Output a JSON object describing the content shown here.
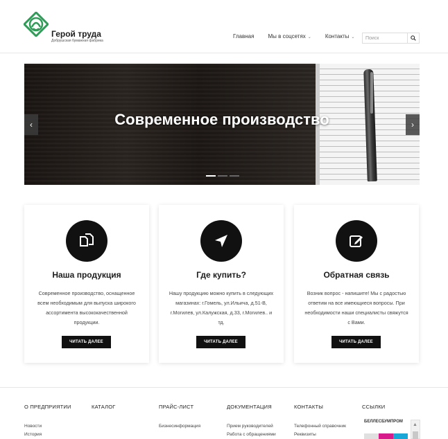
{
  "header": {
    "logo_title": "Герой труда",
    "logo_subtitle": "Добрушская бумажная фабрика",
    "nav": [
      {
        "label": "Главная",
        "has_dropdown": false
      },
      {
        "label": "Мы в соцсетях",
        "has_dropdown": true
      },
      {
        "label": "Контакты",
        "has_dropdown": true
      }
    ],
    "search_placeholder": "Поиск",
    "brand_color": "#2e9b57"
  },
  "slider": {
    "title": "Современное производство",
    "slide_count": 3,
    "active_slide": 1
  },
  "cards": [
    {
      "icon": "documents-icon",
      "title": "Наша продукция",
      "text": "Современное производство, оснащенное всем необходимым для выпуска широкого ассортимента высококачественной продукции.",
      "button": "ЧИТАТЬ ДАЛЕЕ"
    },
    {
      "icon": "location-arrow-icon",
      "title": "Где купить?",
      "text": "Нашу продукцию можно купить в следующих магазинах: г.Гомель, ул.Ильича, д.51-В, г.Могилев, ул.Калужская, д.33, г.Могилев.. и тд.",
      "button": "ЧИТАТЬ ДАЛЕЕ"
    },
    {
      "icon": "edit-icon",
      "title": "Обратная связь",
      "text": "Возник вопрос - напишите! Мы с радостью ответим на все имеющиеся вопросы. При необходимости наши специалисты свяжутся с Вами.",
      "button": "ЧИТАТЬ ДАЛЕЕ"
    }
  ],
  "footer": {
    "columns": [
      {
        "heading": "О ПРЕДПРИЯТИИ",
        "links": [
          "Новости",
          "История"
        ]
      },
      {
        "heading": "КАТАЛОГ",
        "links": []
      },
      {
        "heading": "ПРАЙС-ЛИСТ",
        "links": [
          "Бизнесинформация"
        ]
      },
      {
        "heading": "ДОКУМЕНТАЦИЯ",
        "links": [
          "Прием руководителей",
          "Работа с обращениями"
        ]
      },
      {
        "heading": "КОНТАКТЫ",
        "links": [
          "Телефонный справочник",
          "Реквизиты"
        ]
      },
      {
        "heading": "ССЫЛКИ",
        "links": []
      }
    ],
    "partner_logo_text": "БЕЛЛЕСБУМПРОМ"
  }
}
